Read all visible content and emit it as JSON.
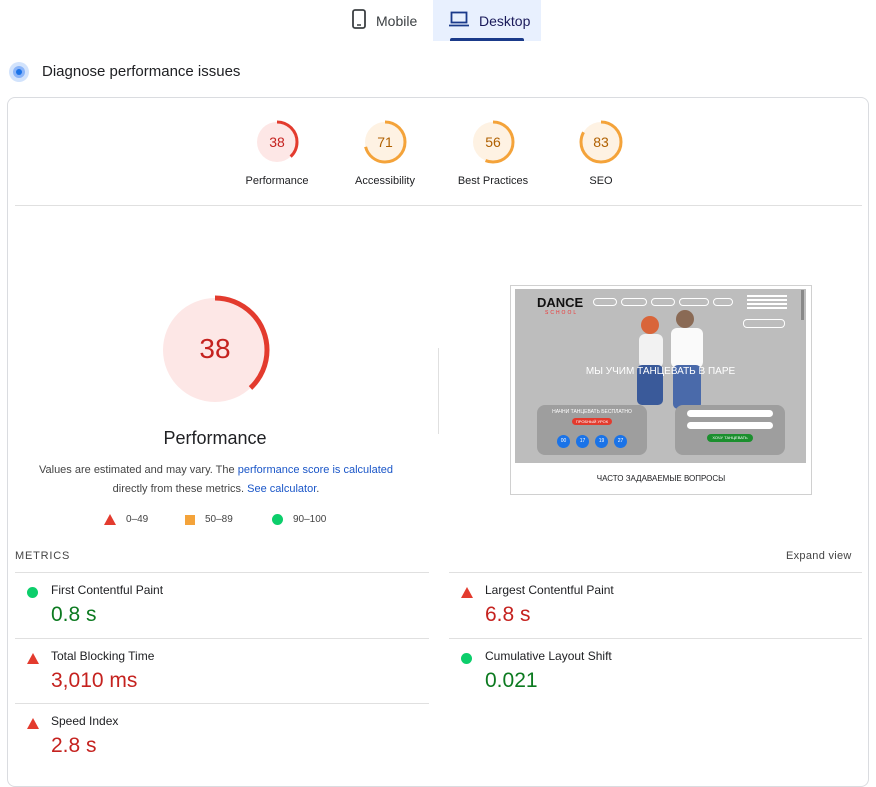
{
  "tabs": {
    "mobile_label": "Mobile",
    "desktop_label": "Desktop"
  },
  "diagnose": {
    "title": "Diagnose performance issues"
  },
  "categories": [
    {
      "label": "Performance",
      "score": "38",
      "color": "#e33b2e",
      "value": 38
    },
    {
      "label": "Accessibility",
      "score": "71",
      "color": "#f4a33a",
      "value": 71
    },
    {
      "label": "Best Practices",
      "score": "56",
      "color": "#f4a33a",
      "value": 56
    },
    {
      "label": "SEO",
      "score": "83",
      "color": "#f4a33a",
      "value": 83
    }
  ],
  "main": {
    "score": "38",
    "value": 38,
    "label": "Performance",
    "desc_pre": "Values are estimated and may vary. The ",
    "desc_link1": "performance score is calculated",
    "desc_mid": " directly from these metrics. ",
    "desc_link2": "See calculator",
    "desc_post": "."
  },
  "legend": [
    {
      "range": "0–49",
      "shape": "triangle",
      "color": "#e33b2e"
    },
    {
      "range": "50–89",
      "shape": "square",
      "color": "#f4a33a"
    },
    {
      "range": "90–100",
      "shape": "circle",
      "color": "#0cce6b"
    }
  ],
  "thumbnail": {
    "headline": "МЫ УЧИМ ТАНЦЕВАТЬ В ПАРЕ",
    "footer": "ЧАСТО ЗАДАВАЕМЫЕ ВОПРОСЫ",
    "logo": "DANCE",
    "logo_sub": "SCHOOL",
    "form_title": "НАЧНИ ТАНЦЕВАТЬ БЕСПЛАТНО",
    "trial": "ПРОБНЫЙ УРОК",
    "cta": "ХОЧУ ТАНЦЕВАТЬ",
    "countdown": [
      "00",
      "17",
      "19",
      "27"
    ]
  },
  "metrics": {
    "header": "METRICS",
    "expand": "Expand view",
    "items": [
      {
        "name": "First Contentful Paint",
        "value": "0.8 s",
        "status": "good"
      },
      {
        "name": "Largest Contentful Paint",
        "value": "6.8 s",
        "status": "poor"
      },
      {
        "name": "Total Blocking Time",
        "value": "3,010 ms",
        "status": "poor"
      },
      {
        "name": "Cumulative Layout Shift",
        "value": "0.021",
        "status": "good"
      },
      {
        "name": "Speed Index",
        "value": "2.8 s",
        "status": "poor"
      }
    ]
  }
}
